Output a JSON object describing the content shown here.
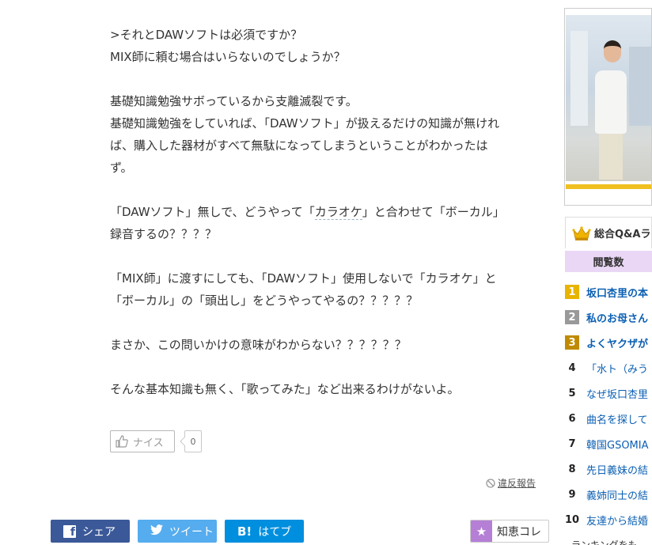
{
  "answer": {
    "paragraphs": [
      [
        ">それとDAWソフトは必須ですか？",
        "MIX師に頼む場合はいらないのでしょうか？"
      ],
      [
        "基礎知識勉強サボっているから支離滅裂です。",
        "基礎知識勉強をしていれば、「DAWソフト」が扱えるだけの知識が無けれ",
        "ば、購入した器材がすべて無駄になってしまうということがわかったは",
        "ず。"
      ],
      [
        "「DAWソフト」無しで、どうやって「",
        "カラオケ",
        "」と合わせて「ボーカル」",
        "録音するの？？？？"
      ],
      [
        "「MIX師」に渡すにしても、「DAWソフト」使用しないで「カラオケ」と",
        "「ボーカル」の「頭出し」をどうやってやるの？？？？？"
      ],
      [
        "まさか、この問いかけの意味がわからない？？？？？？"
      ],
      [
        "そんな基本知識も無く、「歌ってみた」など出来るわけがないよ。"
      ]
    ]
  },
  "nice": {
    "label": "ナイス",
    "count": "0"
  },
  "report": {
    "label": "違反報告"
  },
  "share": {
    "facebook": "シェア",
    "twitter": "ツイート",
    "hatena": "はてブ",
    "hatena_icon": "B!"
  },
  "chie_collection": {
    "label": "知恵コレ"
  },
  "ranking": {
    "title": "総合Q&Aラ",
    "tab": "閲覧数",
    "items": [
      {
        "rank": "1",
        "title": "坂口杏里の本"
      },
      {
        "rank": "2",
        "title": "私のお母さん"
      },
      {
        "rank": "3",
        "title": "よくヤクザが"
      },
      {
        "rank": "4",
        "title": "「水ト（みう"
      },
      {
        "rank": "5",
        "title": "なぜ坂口杏里"
      },
      {
        "rank": "6",
        "title": "曲名を探して"
      },
      {
        "rank": "7",
        "title": "韓国GSOMIA"
      },
      {
        "rank": "8",
        "title": "先日義妹の結"
      },
      {
        "rank": "9",
        "title": "義姉同士の結"
      },
      {
        "rank": "10",
        "title": "友達から結婚"
      }
    ],
    "more_partial": "ランキングをも"
  },
  "icons": {
    "thumb": "thumbs-up-icon",
    "crown": "crown-icon",
    "prohibit": "prohibit-icon",
    "star": "star-icon"
  }
}
